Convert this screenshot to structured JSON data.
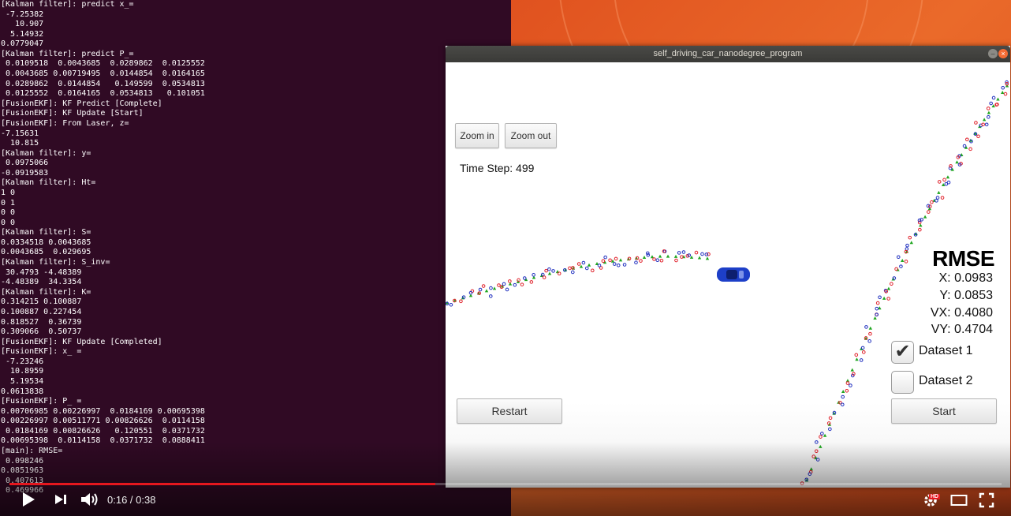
{
  "terminal": {
    "lines": [
      "[Kalman filter]: predict x_=",
      " -7.25382",
      "   10.907",
      "  5.14932",
      "0.0779047",
      "[Kalman filter]: predict P_=",
      " 0.0109518  0.0043685  0.0289862  0.0125552",
      " 0.0043685 0.00719495  0.0144854  0.0164165",
      " 0.0289862  0.0144854   0.149599  0.0534813",
      " 0.0125552  0.0164165  0.0534813   0.101051",
      "[FusionEKF]: KF Predict [Complete]",
      "[FusionEKF]: KF Update [Start]",
      "[FusionEKF]: From Laser, z=",
      "-7.15631",
      "  10.815",
      "[Kalman filter]: y=",
      " 0.0975066",
      "-0.0919583",
      "[Kalman filter]: Ht=",
      "1 0",
      "0 1",
      "0 0",
      "0 0",
      "[Kalman filter]: S=",
      "0.0334518 0.0043685",
      "0.0043685  0.029695",
      "[Kalman filter]: S_inv=",
      " 30.4793 -4.48389",
      "-4.48389  34.3354",
      "[Kalman filter]: K=",
      "0.314215 0.100887",
      "0.100887 0.227454",
      "0.818527  0.36739",
      "0.309066  0.50737",
      "[FusionEKF]: KF Update [Completed]",
      "[FusionEKF]: x_ =",
      " -7.23246",
      "  10.8959",
      "  5.19534",
      "0.0613838",
      "[FusionEKF]: P_ =",
      "0.00706985 0.00226997  0.0184169 0.00695398",
      "0.00226997 0.00511771 0.00826626  0.0114158",
      " 0.0184169 0.00826626   0.120551  0.0371732",
      "0.00695398  0.0114158  0.0371732  0.0888411",
      "[main]: RMSE=",
      " 0.098246",
      "0.0851963",
      " 0.407613",
      " 0.469966"
    ]
  },
  "window": {
    "title": "self_driving_car_nanodegree_program",
    "minimize_icon": "minimize-icon",
    "close_icon": "close-icon"
  },
  "simulator": {
    "zoom_in_label": "Zoom in",
    "zoom_out_label": "Zoom out",
    "time_step": "Time Step: 499",
    "rmse_title": "RMSE",
    "rmse": {
      "x": "X: 0.0983",
      "y": "Y: 0.0853",
      "vx": "VX: 0.4080",
      "vy": "VY: 0.4704"
    },
    "dataset1_label": "Dataset 1",
    "dataset1_checked": true,
    "dataset2_label": "Dataset 2",
    "dataset2_checked": false,
    "restart_label": "Restart",
    "start_label": "Start",
    "colors": {
      "laser": "#e0202a",
      "radar": "#1f2fbf",
      "estimate": "#1fa51f",
      "car": "#1d3fc8"
    }
  },
  "player": {
    "time": "0:16 / 0:38",
    "progress": 0.429,
    "icons": [
      "play-icon",
      "next-icon",
      "volume-icon",
      "settings-icon",
      "hd-badge",
      "theater-icon",
      "fullscreen-icon"
    ],
    "hd_badge": "HD",
    "accent": "#e5171e"
  }
}
